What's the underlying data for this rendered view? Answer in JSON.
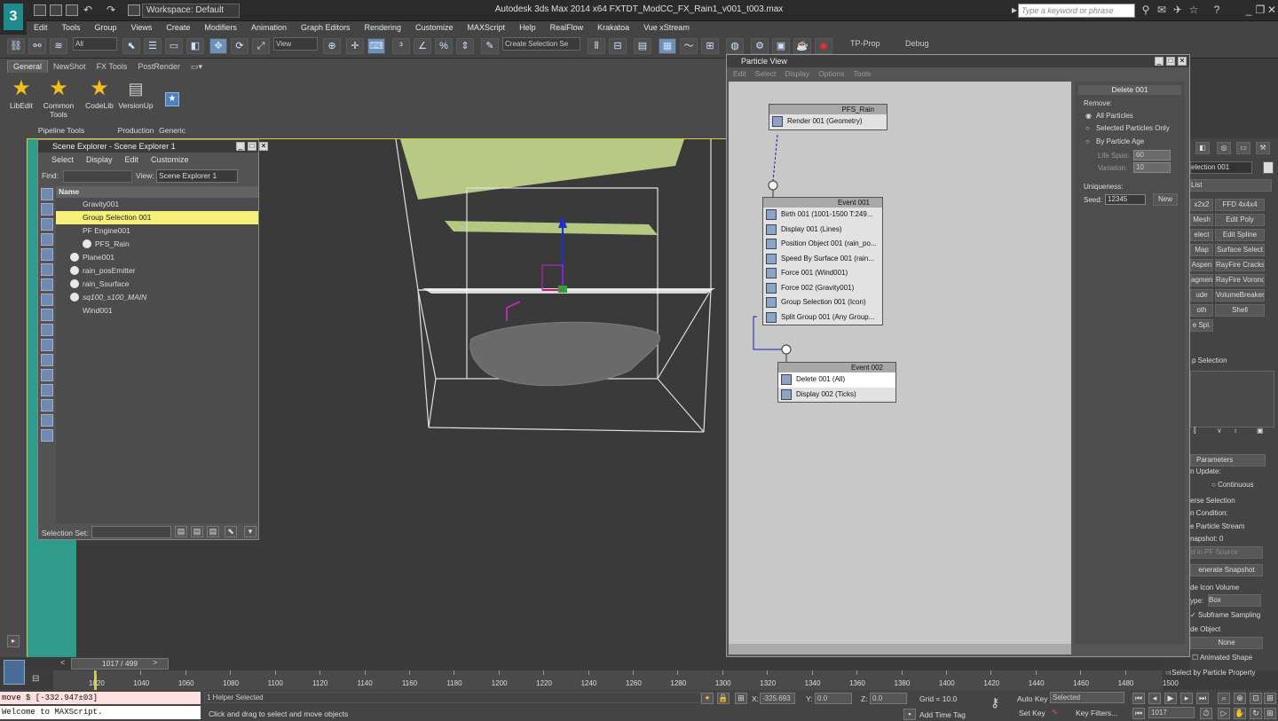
{
  "title_bar": {
    "workspace": "Workspace: Default",
    "app_title": "Autodesk 3ds Max  2014 x64       FXTDT_ModCC_FX_Rain1_v001_t003.max",
    "search_placeholder": "Type a keyword or phrase"
  },
  "menu": [
    "Edit",
    "Tools",
    "Group",
    "Views",
    "Create",
    "Modifiers",
    "Animation",
    "Graph Editors",
    "Rendering",
    "Customize",
    "MAXScript",
    "Help",
    "RealFlow",
    "Krakatoa",
    "Vue xStream"
  ],
  "toolbar": {
    "filter": "All",
    "ref_coord": "View",
    "selection_set": "Create Selection Se",
    "tp_prop": "TP-Prop",
    "debug": "Debug"
  },
  "ribbon": {
    "tabs": [
      "General",
      "NewShot",
      "FX Tools",
      "PostRender"
    ],
    "buttons": [
      "LibEdit",
      "Common Tools",
      "CodeLib",
      "VersionUp"
    ],
    "groups": [
      "Pipeline Tools",
      "Production",
      "Generic"
    ]
  },
  "scene_explorer": {
    "title": "Scene Explorer - Scene Explorer 1",
    "menu": [
      "Select",
      "Display",
      "Edit",
      "Customize"
    ],
    "find_label": "Find:",
    "view_label": "View:",
    "view_value": "Scene Explorer 1",
    "column": "Name",
    "rows": [
      {
        "name": "Gravity001",
        "indent": 0,
        "selected": false,
        "icon": false
      },
      {
        "name": "Group Selection 001",
        "indent": 0,
        "selected": true,
        "icon": false
      },
      {
        "name": "PF Engine001",
        "indent": 0,
        "selected": false,
        "icon": false
      },
      {
        "name": "PFS_Rain",
        "indent": 1,
        "selected": false,
        "icon": true
      },
      {
        "name": "Plane001",
        "indent": 0,
        "selected": false,
        "icon": true
      },
      {
        "name": "rain_posEmitter",
        "indent": 0,
        "selected": false,
        "icon": true
      },
      {
        "name": "rain_Ssurface",
        "indent": 0,
        "selected": false,
        "icon": true
      },
      {
        "name": "sq100_s100_MAIN",
        "indent": 0,
        "selected": false,
        "icon": true
      },
      {
        "name": "Wind001",
        "indent": 0,
        "selected": false,
        "icon": false
      }
    ],
    "selection_set_label": "Selection Set:"
  },
  "particle_view": {
    "title": "Particle View",
    "menu": [
      "Edit",
      "Select",
      "Display",
      "Options",
      "Tools"
    ],
    "source_node": {
      "title": "PFS_Rain",
      "rows": [
        "Render 001 (Geometry)"
      ]
    },
    "event1": {
      "title": "Event 001",
      "rows": [
        "Birth 001 (1001-1500 T:249...",
        "Display 001 (Lines)",
        "Position Object 001 (rain_po...",
        "Speed By Surface 001 (rain...",
        "Force 001 (Wind001)",
        "Force 002 (Gravity001)",
        "Group Selection 001 (Icon)",
        "Split Group 001 (Any Group..."
      ]
    },
    "event2": {
      "title": "Event 002",
      "rows": [
        "Delete 001 (All)",
        "Display 002 (Ticks)"
      ]
    },
    "props": {
      "title": "Delete 001",
      "remove_label": "Remove:",
      "options": [
        "All Particles",
        "Selected Particles Only",
        "By Particle Age"
      ],
      "life_span_label": "Life Span:",
      "life_span": "60",
      "variation_label": "Variation:",
      "variation": "10",
      "uniqueness_label": "Uniqueness:",
      "seed_label": "Seed:",
      "seed": "12345",
      "new_button": "New"
    }
  },
  "command_panel": {
    "selection_name": "election 001",
    "list": "List",
    "buttons": [
      "x2x2",
      "FFD 4x4x4",
      "Mesh",
      "Edit Poly",
      "elect",
      "Edit Spline",
      "Map",
      "Surface Select",
      "Aspen",
      "RayFire Cracks",
      "agmen",
      "RayFire Vorono",
      "ude",
      "VolumeBreaker",
      "oth",
      "Shell",
      "e Spl."
    ],
    "group_label": "p Selection",
    "params_title": "Parameters",
    "on_update": "n Update:",
    "continuous": "Continuous",
    "texts": [
      "erse Selection",
      "n Condition:",
      "e Particle Stream",
      "napshot: 0",
      "d in PF Source",
      "enerate Snapshot",
      "de Icon Volume",
      "ype:",
      "Subframe Sampling",
      "de Object",
      "None",
      "Animated Shape",
      "Select by Particle Property"
    ],
    "type_value": "Box"
  },
  "timeline": {
    "frame": "1017 / 499",
    "labels": [
      "1020",
      "1040",
      "1060",
      "1080",
      "1100",
      "1120",
      "1140",
      "1160",
      "1180",
      "1200",
      "1220",
      "1240",
      "1260",
      "1280",
      "1300",
      "1320",
      "1340",
      "1360",
      "1380",
      "1400",
      "1420",
      "1440",
      "1460",
      "1480",
      "1500"
    ]
  },
  "status": {
    "maxscript_line1": "move $ [-332.947±03]",
    "maxscript_line2": "Welcome to MAXScript.",
    "helper": "1 Helper Selected",
    "prompt": "Click and drag to select and move objects",
    "x_value": "-325.693",
    "y_value": "0.0",
    "z_value": "0.0",
    "grid": "Grid = 10.0",
    "add_time_tag": "Add Time Tag",
    "auto_key": "Auto Key",
    "key_mode": "Selected",
    "set_key": "Set Key",
    "key_filters": "Key Filters...",
    "current_frame": "1017"
  }
}
